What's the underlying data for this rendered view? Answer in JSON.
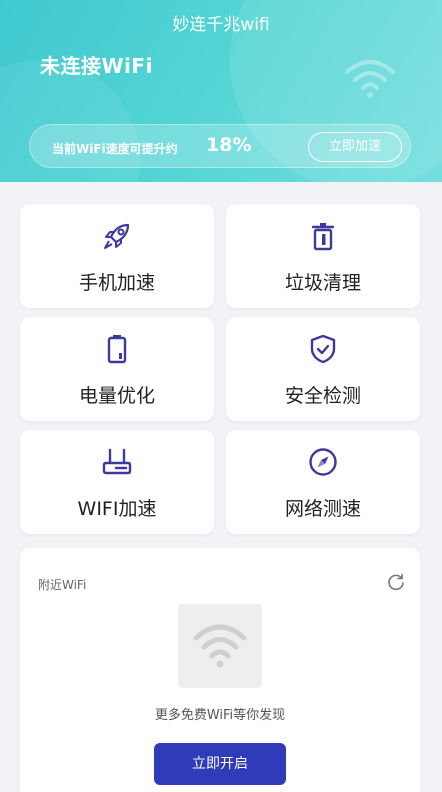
{
  "header": {
    "app_title": "妙连千兆wifi",
    "status": "未连接WiFi",
    "speed_text": "当前WiFi速度可提升约",
    "speed_value": "18%",
    "speed_button": "立即加速"
  },
  "tools": [
    {
      "label": "手机加速",
      "icon": "rocket-icon"
    },
    {
      "label": "垃圾清理",
      "icon": "trash-icon"
    },
    {
      "label": "电量优化",
      "icon": "battery-icon"
    },
    {
      "label": "安全检测",
      "icon": "shield-check-icon"
    },
    {
      "label": "WIFI加速",
      "icon": "router-icon"
    },
    {
      "label": "网络测速",
      "icon": "compass-icon"
    }
  ],
  "nearby": {
    "title": "附近WiFi",
    "discover_text": "更多免费WiFi等你发现",
    "open_button": "立即开启"
  },
  "colors": {
    "header_teal": "#52d4d4",
    "icon_purple": "#3d3a9c",
    "button_blue": "#2f3bb8"
  }
}
